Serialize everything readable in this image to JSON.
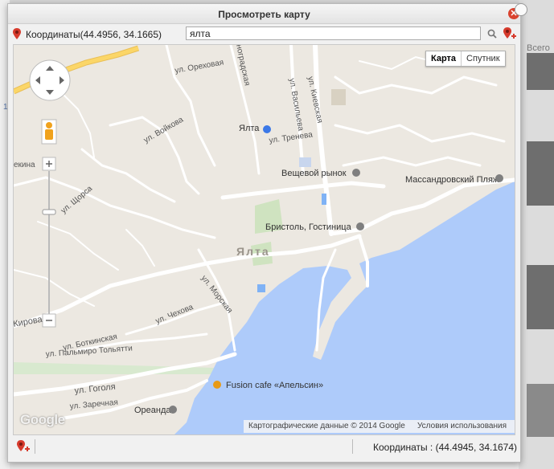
{
  "dialog": {
    "title": "Просмотреть карту",
    "coordinates_label": "Координаты(44.4956, 34.1665)",
    "search_value": "ялта",
    "status_coordinates": "Координаты : (44.4945, 34.1674)"
  },
  "map": {
    "type_buttons": {
      "map": "Карта",
      "satellite": "Спутник"
    },
    "attribution": "Картографические данные © 2014 Google",
    "terms": "Условия использования",
    "logo": "Google",
    "city_label": "Ялта",
    "labels": {
      "yalta_station": "Ялта",
      "market": "Вещевой рынок",
      "massandra": "Массандровский Пляж",
      "bristol": "Бристоль, Гостиница",
      "fusion": "Fusion cafe «Апельсин»",
      "oreanda": "Ореанда",
      "kievskaya": "ул. Киевская",
      "vasilyeva": "ул. Васильева",
      "treneva": "ул. Тренева",
      "voykova": "ул. Войкова",
      "shchorsa": "ул. Щорса",
      "kirova": "Кирова",
      "morskaya": "ул. Морская",
      "chekhova": "ул. Чехова",
      "botkinskaya": "ул. Боткинская",
      "tolyatti": "ул. Пальмиро Тольятти",
      "gogolya": "ул. Гоголя",
      "zarechnaya": "ул. Заречная",
      "ekina": "екина",
      "orekhovaya": "ул. Ореховая",
      "nogradskaya": "ноградская"
    }
  },
  "background": {
    "label": "Всего",
    "left_number": "1"
  },
  "colors": {
    "water": "#aecbfa",
    "land": "#ece8e1",
    "park": "#cfe3c0",
    "road": "#ffffff",
    "highway": "#fbd668",
    "close": "#d9432f",
    "pin": "#d63a2c"
  }
}
